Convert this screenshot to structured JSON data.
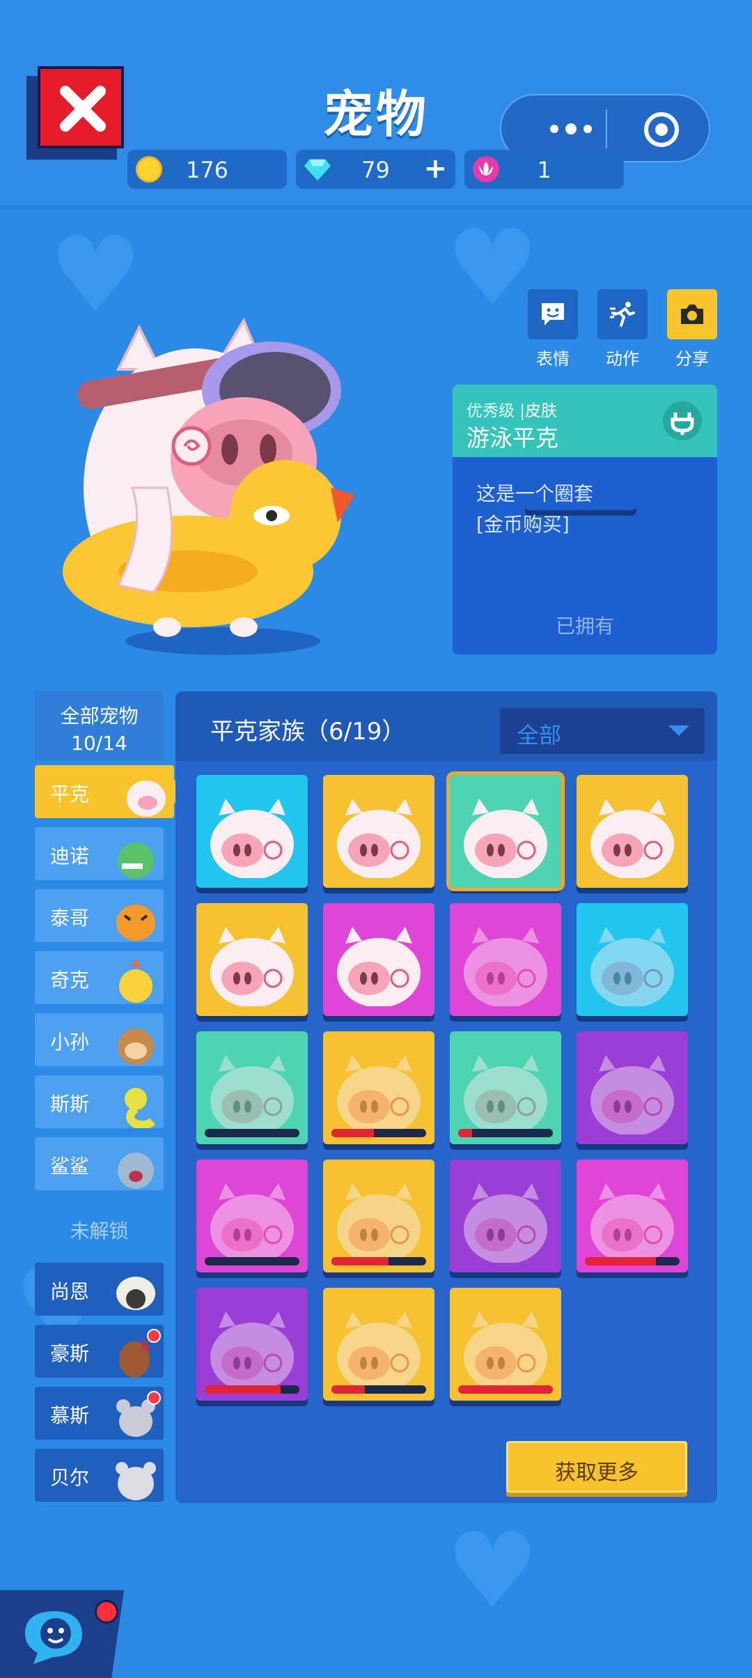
{
  "header": {
    "title": "宠物",
    "close_icon": "close-x-icon",
    "menu_icons": [
      "more-dots-icon",
      "target-icon"
    ]
  },
  "currency": {
    "coins": "176",
    "diamonds": "79",
    "diamond_plus": "+",
    "lotus": "1"
  },
  "actions": {
    "emote_label": "表情",
    "motion_label": "动作",
    "share_label": "分享"
  },
  "skin_info": {
    "rarity": "优秀级",
    "separator": " | ",
    "category": "皮肤",
    "name": "游泳平克",
    "desc_line1": "这是一个圈套",
    "desc_line2": "[金币购买]",
    "status": "已拥有"
  },
  "sidebar": {
    "all_label": "全部宠物",
    "all_count": "10/14",
    "unlocked": [
      {
        "label": "平克",
        "active": true
      },
      {
        "label": "迪诺"
      },
      {
        "label": "泰哥"
      },
      {
        "label": "奇克"
      },
      {
        "label": "小孙"
      },
      {
        "label": "斯斯"
      },
      {
        "label": "鲨鲨"
      }
    ],
    "locked_label": "未解锁",
    "locked": [
      {
        "label": "尚恩"
      },
      {
        "label": "豪斯"
      },
      {
        "label": "慕斯"
      },
      {
        "label": "贝尔"
      }
    ]
  },
  "panel": {
    "family_title": "平克家族（6/19）",
    "filter_label": "全部",
    "get_more": "获取更多"
  },
  "skins": [
    {
      "bg": "#20c6ee",
      "owned": true
    },
    {
      "bg": "#f5c232",
      "owned": true
    },
    {
      "bg": "#4fd4b2",
      "owned": true,
      "selected": true
    },
    {
      "bg": "#f5c232",
      "owned": true
    },
    {
      "bg": "#f5c232",
      "owned": true
    },
    {
      "bg": "#e046d6",
      "owned": true
    },
    {
      "bg": "#e046d6",
      "owned": false
    },
    {
      "bg": "#20c6ee",
      "owned": false
    },
    {
      "bg": "#4fd4b2",
      "owned": false,
      "progress": 0
    },
    {
      "bg": "#f5c232",
      "owned": false,
      "progress": 0.45
    },
    {
      "bg": "#4fd4b2",
      "owned": false,
      "progress": 0.15
    },
    {
      "bg": "#9a3ed6",
      "owned": false
    },
    {
      "bg": "#e046d6",
      "owned": false,
      "progress": 0
    },
    {
      "bg": "#f5c232",
      "owned": false,
      "progress": 0.6
    },
    {
      "bg": "#9a3ed6",
      "owned": false
    },
    {
      "bg": "#e046d6",
      "owned": false,
      "progress": 0.75
    },
    {
      "bg": "#9a3ed6",
      "owned": false,
      "progress": 0.8
    },
    {
      "bg": "#f5c232",
      "owned": false,
      "progress": 0.35
    },
    {
      "bg": "#f5c232",
      "owned": false,
      "progress": 1
    }
  ]
}
